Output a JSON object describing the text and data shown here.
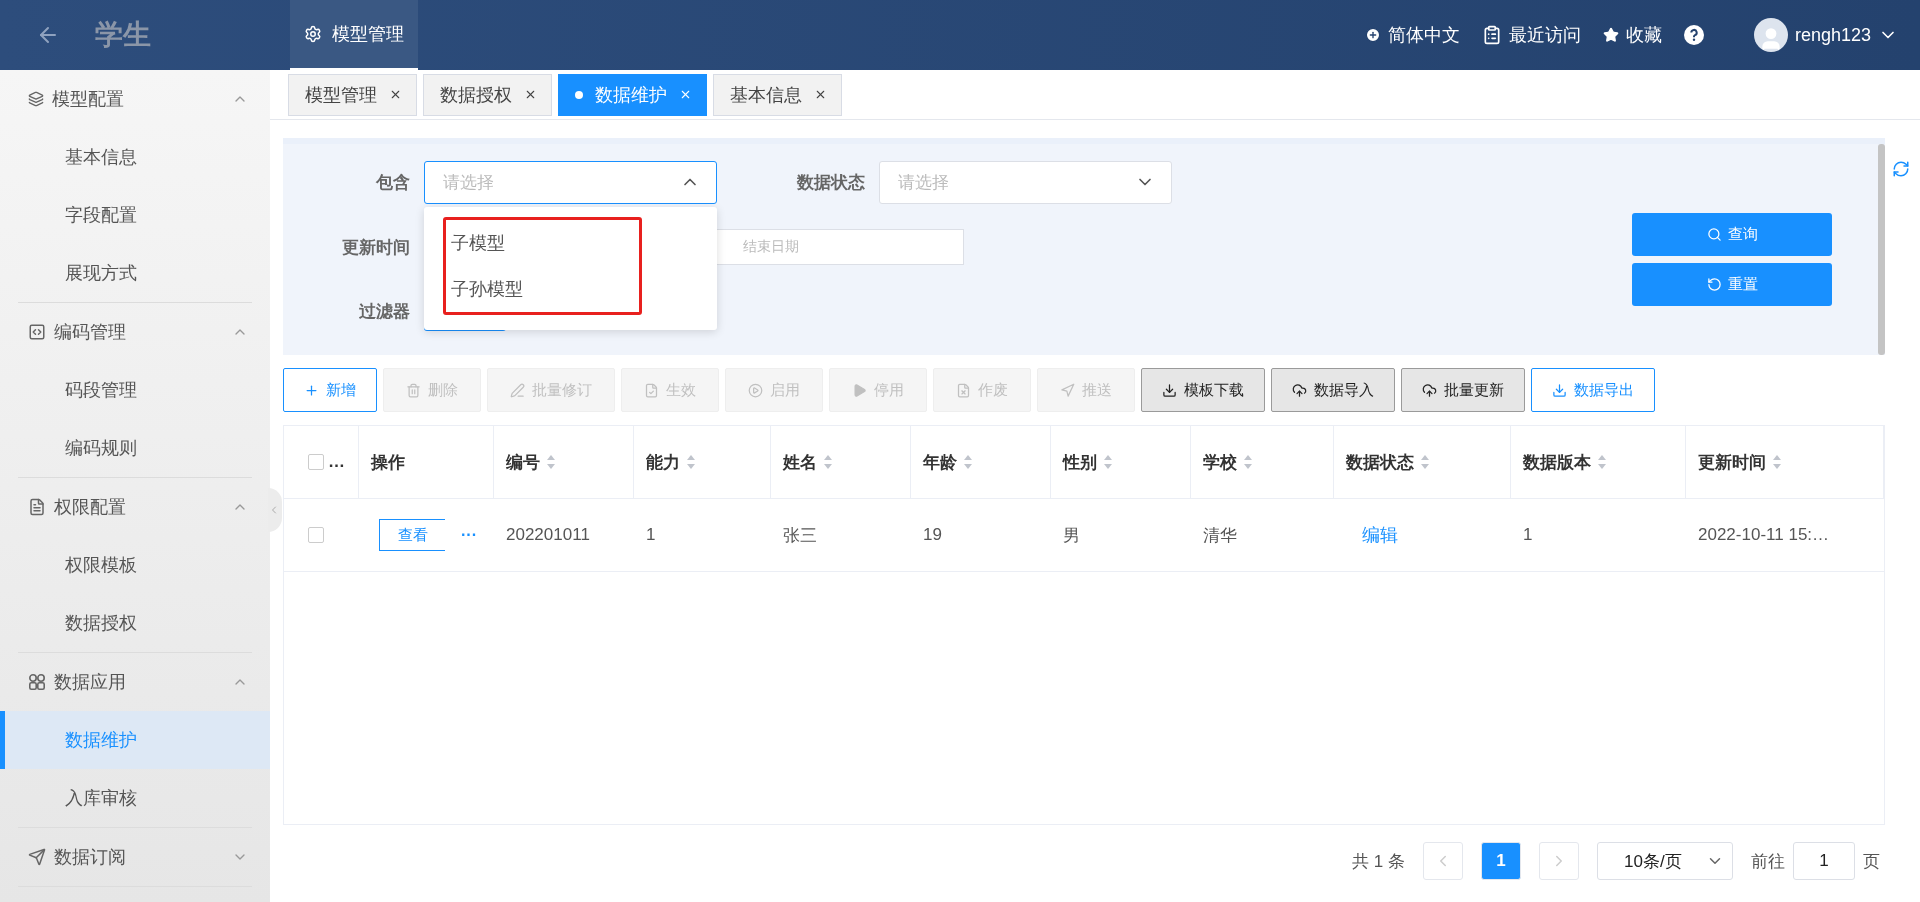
{
  "header": {
    "app_title": "学生",
    "nav": [
      {
        "label": "模型管理",
        "selected": true
      }
    ],
    "language": "简体中文",
    "recent": "最近访问",
    "favorites": "收藏",
    "user": "rengh123"
  },
  "sidebar": {
    "groups": [
      {
        "label": "模型配置",
        "expanded": true,
        "items": [
          {
            "label": "基本信息",
            "selected": false
          },
          {
            "label": "字段配置",
            "selected": false
          },
          {
            "label": "展现方式",
            "selected": false
          }
        ]
      },
      {
        "label": "编码管理",
        "expanded": true,
        "items": [
          {
            "label": "码段管理",
            "selected": false
          },
          {
            "label": "编码规则",
            "selected": false
          }
        ]
      },
      {
        "label": "权限配置",
        "expanded": true,
        "items": [
          {
            "label": "权限模板",
            "selected": false
          },
          {
            "label": "数据授权",
            "selected": false
          }
        ]
      },
      {
        "label": "数据应用",
        "expanded": true,
        "items": [
          {
            "label": "数据维护",
            "selected": true
          },
          {
            "label": "入库审核",
            "selected": false
          }
        ]
      },
      {
        "label": "数据订阅",
        "expanded": false
      }
    ]
  },
  "page_tabs": [
    {
      "label": "模型管理",
      "selected": false
    },
    {
      "label": "数据授权",
      "selected": false
    },
    {
      "label": "数据维护",
      "selected": true
    },
    {
      "label": "基本信息",
      "selected": false
    }
  ],
  "filters": {
    "contains": {
      "label": "包含",
      "placeholder": "请选择",
      "open": true,
      "options": [
        {
          "label": "子模型"
        },
        {
          "label": "子孙模型"
        }
      ]
    },
    "status": {
      "label": "数据状态",
      "placeholder": "请选择",
      "open": false
    },
    "update_time": {
      "label": "更新时间",
      "end_placeholder": "结束日期"
    },
    "filter": {
      "label": "过滤器"
    },
    "actions": [
      {
        "label": "查询",
        "kind": "search"
      },
      {
        "label": "重置",
        "kind": "reset"
      }
    ]
  },
  "toolbar": [
    {
      "label": "新增",
      "kind": "outline"
    },
    {
      "label": "删除",
      "kind": "disabled"
    },
    {
      "label": "批量修订",
      "kind": "disabled"
    },
    {
      "label": "生效",
      "kind": "disabled"
    },
    {
      "label": "启用",
      "kind": "disabled"
    },
    {
      "label": "停用",
      "kind": "disabled"
    },
    {
      "label": "作废",
      "kind": "disabled"
    },
    {
      "label": "推送",
      "kind": "disabled"
    },
    {
      "label": "模板下载",
      "kind": "default"
    },
    {
      "label": "数据导入",
      "kind": "default"
    },
    {
      "label": "批量更新",
      "kind": "default"
    },
    {
      "label": "数据导出",
      "kind": "outline"
    }
  ],
  "table": {
    "columns": [
      {
        "kind": "checkbox",
        "label": "…",
        "checked": false
      },
      {
        "kind": "text",
        "label": "操作",
        "sortable": false
      },
      {
        "label": "编号",
        "sortable": true
      },
      {
        "label": "能力",
        "sortable": true
      },
      {
        "label": "姓名",
        "sortable": true
      },
      {
        "label": "年龄",
        "sortable": true
      },
      {
        "label": "性别",
        "sortable": true
      },
      {
        "label": "学校",
        "sortable": true
      },
      {
        "label": "数据状态",
        "sortable": true
      },
      {
        "label": "数据版本",
        "sortable": true
      },
      {
        "label": "更新时间",
        "sortable": true
      }
    ],
    "rows": [
      {
        "cells": [
          {
            "kind": "checkbox",
            "checked": false
          },
          {
            "kind": "actions",
            "view": "查看",
            "more": "···"
          },
          {
            "kind": "text",
            "text": "202201011"
          },
          {
            "kind": "text",
            "text": "1"
          },
          {
            "kind": "text",
            "text": "张三"
          },
          {
            "kind": "text",
            "text": "19"
          },
          {
            "kind": "text",
            "text": "男"
          },
          {
            "kind": "text",
            "text": "清华"
          },
          {
            "kind": "link",
            "text": "编辑"
          },
          {
            "kind": "text",
            "text": "1"
          },
          {
            "kind": "text",
            "text": "2022-10-11 15:…"
          }
        ]
      }
    ]
  },
  "pagination": {
    "total": "共 1 条",
    "pages": [
      {
        "label": "1",
        "selected": true
      }
    ],
    "page_size": "10条/页",
    "goto_label": "前往",
    "goto_value": "1",
    "page_unit": "页"
  }
}
